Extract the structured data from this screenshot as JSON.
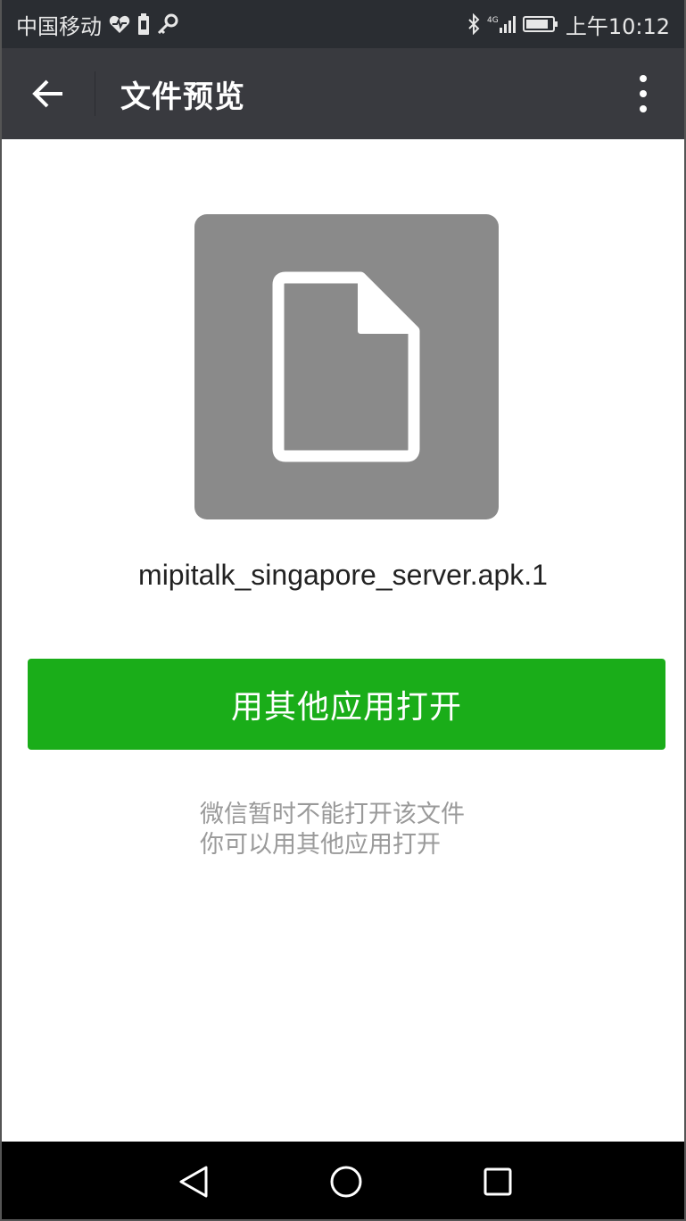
{
  "status_bar": {
    "carrier": "中国移动",
    "time": "上午10:12",
    "network": "4G",
    "icons_left": [
      "heart-icon",
      "battery-saver-icon",
      "key-icon"
    ],
    "icons_right": [
      "bluetooth-icon",
      "signal-icon",
      "battery-icon"
    ]
  },
  "app_bar": {
    "title": "文件预览",
    "back_icon": "arrow-left-icon",
    "more_icon": "more-vertical-icon"
  },
  "file": {
    "icon": "document-icon",
    "name": "mipitalk_singapore_server.apk.1"
  },
  "actions": {
    "open_with_other_app": "用其他应用打开"
  },
  "hint": {
    "line1": "微信暂时不能打开该文件",
    "line2": "你可以用其他应用打开"
  },
  "nav_bar": {
    "back_icon": "triangle-back-icon",
    "home_icon": "circle-home-icon",
    "recents_icon": "square-recents-icon"
  },
  "colors": {
    "status_bar_bg": "#2a2d32",
    "app_bar_bg": "#393a3f",
    "primary_button": "#1aad19",
    "file_icon_bg": "#8a8a8a",
    "hint_text": "#9a9a9a"
  }
}
